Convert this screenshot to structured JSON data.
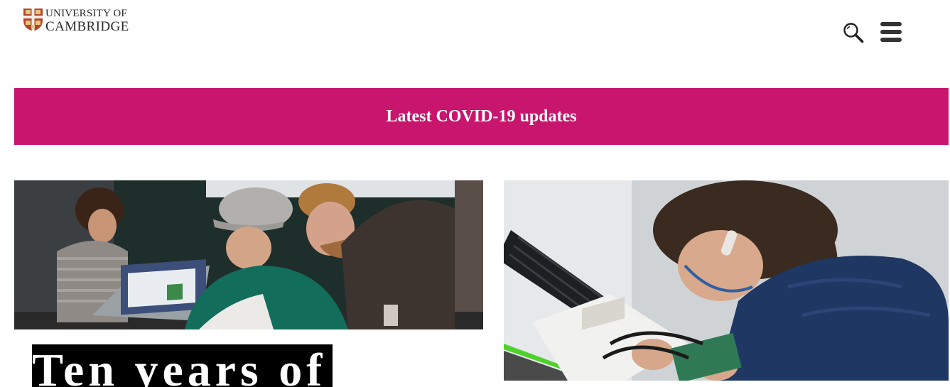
{
  "header": {
    "logo": {
      "line1": "UNIVERSITY OF",
      "line2": "CAMBRIDGE",
      "icon": "cambridge-crest-icon"
    },
    "search_icon": "search-icon",
    "menu_icon": "hamburger-menu-icon"
  },
  "banner": {
    "text": "Latest COVID-19 updates",
    "color": "#c8156e"
  },
  "features": [
    {
      "image": "students-with-laptop-photo",
      "headline": "Ten years of"
    },
    {
      "image": "student-soldering-photo"
    }
  ]
}
